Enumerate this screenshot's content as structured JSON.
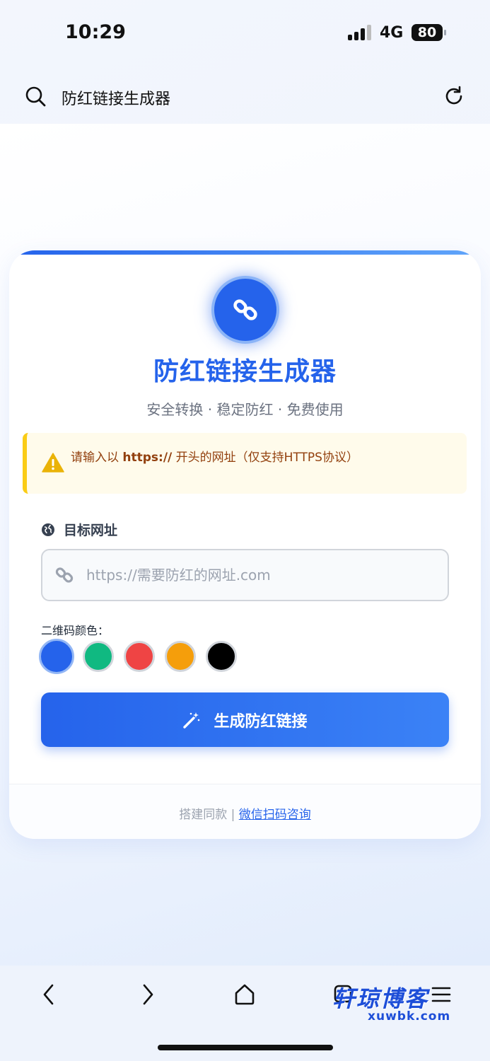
{
  "status_bar": {
    "time": "10:29",
    "network": "4G",
    "battery": "80"
  },
  "browser": {
    "title": "防红链接生成器"
  },
  "card": {
    "title": "防红链接生成器",
    "subtitle": "安全转换 · 稳定防红 · 免费使用",
    "notice": {
      "prefix": "请输入以 ",
      "highlight": "https://",
      "suffix": " 开头的网址（仅支持HTTPS协议）"
    },
    "url_label": "目标网址",
    "url_input": {
      "value": "",
      "placeholder": "https://需要防红的网址.com"
    },
    "color_label": "二维码颜色：",
    "colors": [
      "#2563eb",
      "#10b981",
      "#ef4444",
      "#f59e0b",
      "#000000"
    ],
    "selected_color": "#2563eb",
    "button_label": "生成防红链接",
    "footer": {
      "prefix": "搭建同款 | ",
      "link": "微信扫码咨询"
    }
  },
  "watermark": {
    "title": "轩琼博客",
    "sub": "xuwbk.com"
  }
}
